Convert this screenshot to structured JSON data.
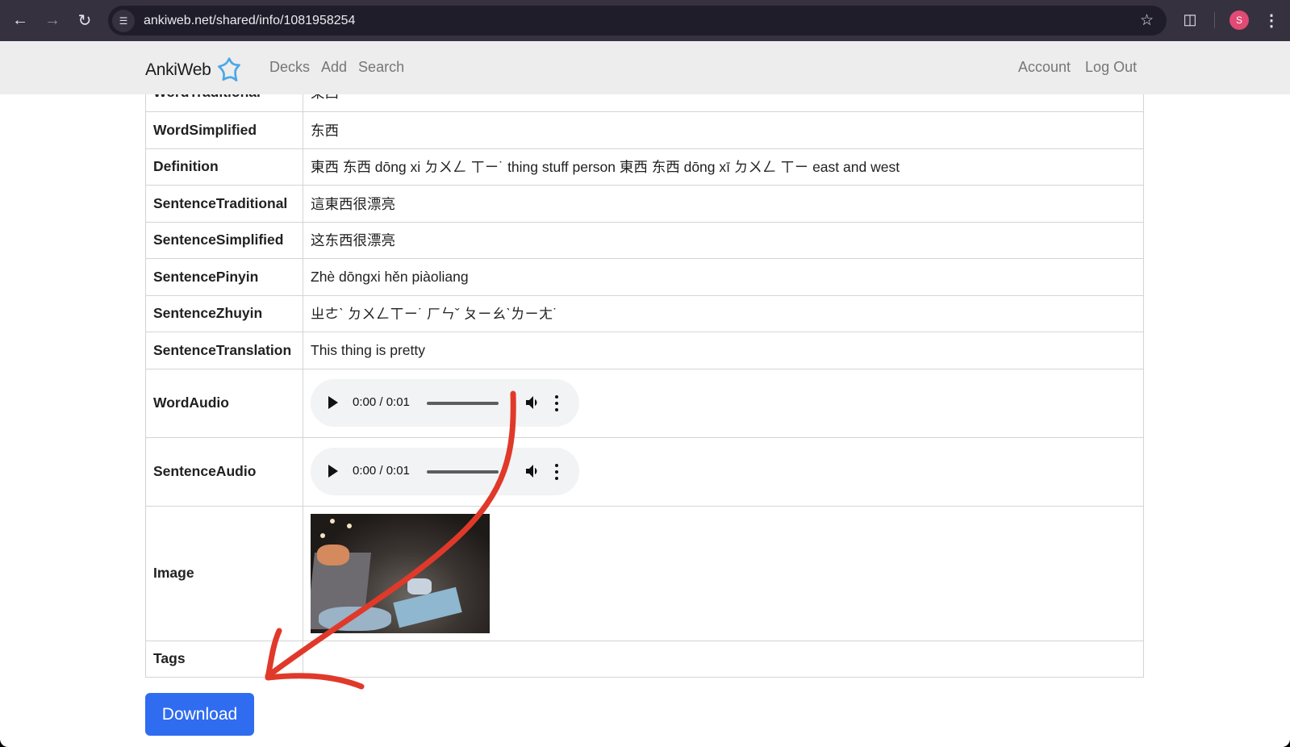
{
  "browser": {
    "url": "ankiweb.net/shared/info/1081958254",
    "back_icon": "arrow-left",
    "forward_icon": "arrow-right",
    "reload_icon": "reload",
    "site_info_icon": "tune",
    "bookmark_icon": "star-outline",
    "extensions_icon": "puzzle",
    "profile_initial": "S",
    "menu_icon": "kebab-vertical",
    "profile_color": "#e04a74"
  },
  "site_nav": {
    "brand": "AnkiWeb",
    "brand_icon": "star-logo",
    "brand_color": "#4aa8e8",
    "links": [
      {
        "label": "Decks"
      },
      {
        "label": "Add"
      },
      {
        "label": "Search"
      }
    ],
    "right_links": [
      {
        "label": "Account"
      },
      {
        "label": "Log Out"
      }
    ]
  },
  "fields": [
    {
      "label": "WordTraditional",
      "value": "東西"
    },
    {
      "label": "WordSimplified",
      "value": "东西"
    },
    {
      "label": "Definition",
      "value": "東西 东西 dōng xi ㄉㄨㄥ ㄒㄧ˙ thing stuff person 東西 东西 dōng xī ㄉㄨㄥ ㄒㄧ east and west"
    },
    {
      "label": "SentenceTraditional",
      "value": "這東西很漂亮"
    },
    {
      "label": "SentenceSimplified",
      "value": "这东西很漂亮"
    },
    {
      "label": "SentencePinyin",
      "value": "Zhè dōngxi hěn piàoliang"
    },
    {
      "label": "SentenceZhuyin",
      "value": "ㄓㄜˋ ㄉㄨㄥㄒㄧ˙ ㄏㄣˇ ㄆㄧㄠˋㄌㄧㄤ˙"
    },
    {
      "label": "SentenceTranslation",
      "value": "This thing is pretty"
    },
    {
      "label": "WordAudio",
      "audio_time": "0:00 / 0:01"
    },
    {
      "label": "SentenceAudio",
      "audio_time": "0:00 / 0:01"
    },
    {
      "label": "Image",
      "image_alt": "photo of a cluttered table with bags and papers"
    },
    {
      "label": "Tags",
      "value": ""
    }
  ],
  "download_label": "Download",
  "download_color": "#2f6cf0",
  "annotation": {
    "type": "arrow",
    "color": "#e0392a",
    "points_to": "download-button"
  }
}
